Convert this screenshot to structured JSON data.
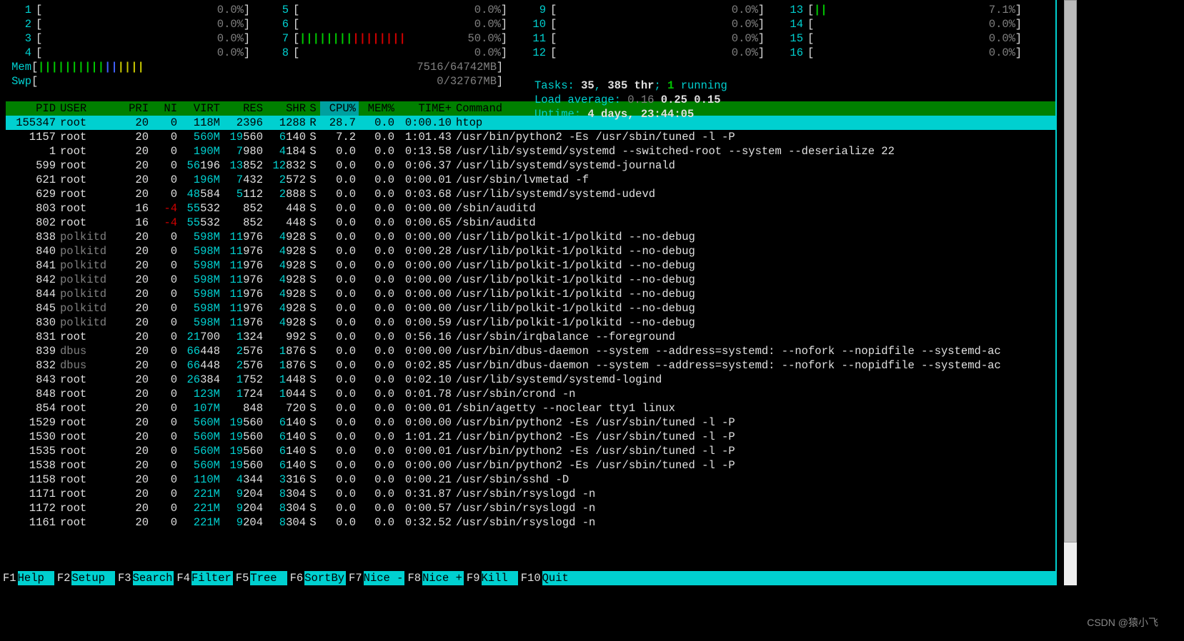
{
  "cpu_meters": [
    {
      "n": "1",
      "pct": "0.0%",
      "bars": ""
    },
    {
      "n": "2",
      "pct": "0.0%",
      "bars": ""
    },
    {
      "n": "3",
      "pct": "0.0%",
      "bars": ""
    },
    {
      "n": "4",
      "pct": "0.0%",
      "bars": ""
    },
    {
      "n": "5",
      "pct": "0.0%",
      "bars": ""
    },
    {
      "n": "6",
      "pct": "0.0%",
      "bars": ""
    },
    {
      "n": "7",
      "pct": "50.0%",
      "bars": "||||||||||||||||"
    },
    {
      "n": "8",
      "pct": "0.0%",
      "bars": ""
    },
    {
      "n": "9",
      "pct": "0.0%",
      "bars": ""
    },
    {
      "n": "10",
      "pct": "0.0%",
      "bars": ""
    },
    {
      "n": "11",
      "pct": "0.0%",
      "bars": ""
    },
    {
      "n": "12",
      "pct": "0.0%",
      "bars": ""
    },
    {
      "n": "13",
      "pct": "7.1%",
      "bars": "||"
    },
    {
      "n": "14",
      "pct": "0.0%",
      "bars": ""
    },
    {
      "n": "15",
      "pct": "0.0%",
      "bars": ""
    },
    {
      "n": "16",
      "pct": "0.0%",
      "bars": ""
    }
  ],
  "mem": {
    "label": "Mem",
    "used": "7516/64742MB",
    "bars": "||||||||||||||||"
  },
  "swp": {
    "label": "Swp",
    "used": "0/32767MB",
    "bars": ""
  },
  "stats": {
    "tasks_label": "Tasks: ",
    "tasks": "35",
    "tasks_sep": ", ",
    "thr": "385 thr",
    "thr_sep": "; ",
    "running": "1",
    "running_label": " running",
    "load_label": "Load average: ",
    "load1": "0.16",
    "load2": "0.25",
    "load3": "0.15",
    "uptime_label": "Uptime: ",
    "uptime": "4 days, 23:44:05"
  },
  "columns": {
    "pid": "PID",
    "user": "USER",
    "pri": "PRI",
    "ni": "NI",
    "virt": "VIRT",
    "res": "RES",
    "shr": "SHR",
    "s": "S",
    "cpu": "CPU%",
    "mem": "MEM%",
    "time": "TIME+",
    "cmd": "Command"
  },
  "procs": [
    {
      "pid": "155347",
      "user": "root",
      "usercls": "",
      "pri": "20",
      "ni": "0",
      "virt_hi": "",
      "virt": "118M",
      "res_hi": "",
      "res": "2396",
      "shr_hi": "",
      "shr": "1288",
      "s": "R",
      "cpu": "28.7",
      "mem": "0.0",
      "time": "0:00.10",
      "cmd": "htop",
      "sel": true
    },
    {
      "pid": "1157",
      "user": "root",
      "pri": "20",
      "ni": "0",
      "virt_hi": "",
      "virt": "560M",
      "res_hi": "19",
      "res": "560",
      "shr_hi": "6",
      "shr": "140",
      "s": "S",
      "cpu": "7.2",
      "mem": "0.0",
      "time": "1:01.43",
      "cmd": "/usr/bin/python2 -Es /usr/sbin/tuned -l -P"
    },
    {
      "pid": "1",
      "user": "root",
      "pri": "20",
      "ni": "0",
      "virt_hi": "",
      "virt": "190M",
      "res_hi": "7",
      "res": "980",
      "shr_hi": "4",
      "shr": "184",
      "s": "S",
      "cpu": "0.0",
      "mem": "0.0",
      "time": "0:13.58",
      "cmd": "/usr/lib/systemd/systemd --switched-root --system --deserialize 22"
    },
    {
      "pid": "599",
      "user": "root",
      "pri": "20",
      "ni": "0",
      "virt_hi": "56",
      "virt": "196",
      "res_hi": "13",
      "res": "852",
      "shr_hi": "12",
      "shr": "832",
      "s": "S",
      "cpu": "0.0",
      "mem": "0.0",
      "time": "0:06.37",
      "cmd": "/usr/lib/systemd/systemd-journald"
    },
    {
      "pid": "621",
      "user": "root",
      "pri": "20",
      "ni": "0",
      "virt_hi": "",
      "virt": "196M",
      "res_hi": "7",
      "res": "432",
      "shr_hi": "2",
      "shr": "572",
      "s": "S",
      "cpu": "0.0",
      "mem": "0.0",
      "time": "0:00.01",
      "cmd": "/usr/sbin/lvmetad -f"
    },
    {
      "pid": "629",
      "user": "root",
      "pri": "20",
      "ni": "0",
      "virt_hi": "48",
      "virt": "584",
      "res_hi": "5",
      "res": "112",
      "shr_hi": "2",
      "shr": "888",
      "s": "S",
      "cpu": "0.0",
      "mem": "0.0",
      "time": "0:03.68",
      "cmd": "/usr/lib/systemd/systemd-udevd"
    },
    {
      "pid": "803",
      "user": "root",
      "pri": "16",
      "ni": "-4",
      "nicls": "red",
      "virt_hi": "55",
      "virt": "532",
      "res_hi": "",
      "res": "852",
      "shr_hi": "",
      "shr": "448",
      "s": "S",
      "cpu": "0.0",
      "mem": "0.0",
      "time": "0:00.00",
      "cmd": "/sbin/auditd"
    },
    {
      "pid": "802",
      "user": "root",
      "pri": "16",
      "ni": "-4",
      "nicls": "red",
      "virt_hi": "55",
      "virt": "532",
      "res_hi": "",
      "res": "852",
      "shr_hi": "",
      "shr": "448",
      "s": "S",
      "cpu": "0.0",
      "mem": "0.0",
      "time": "0:00.65",
      "cmd": "/sbin/auditd"
    },
    {
      "pid": "838",
      "user": "polkitd",
      "usercls": "grey",
      "pri": "20",
      "ni": "0",
      "virt_hi": "",
      "virt": "598M",
      "res_hi": "11",
      "res": "976",
      "shr_hi": "4",
      "shr": "928",
      "s": "S",
      "cpu": "0.0",
      "mem": "0.0",
      "time": "0:00.00",
      "cmd": "/usr/lib/polkit-1/polkitd --no-debug"
    },
    {
      "pid": "840",
      "user": "polkitd",
      "usercls": "grey",
      "pri": "20",
      "ni": "0",
      "virt_hi": "",
      "virt": "598M",
      "res_hi": "11",
      "res": "976",
      "shr_hi": "4",
      "shr": "928",
      "s": "S",
      "cpu": "0.0",
      "mem": "0.0",
      "time": "0:00.28",
      "cmd": "/usr/lib/polkit-1/polkitd --no-debug"
    },
    {
      "pid": "841",
      "user": "polkitd",
      "usercls": "grey",
      "pri": "20",
      "ni": "0",
      "virt_hi": "",
      "virt": "598M",
      "res_hi": "11",
      "res": "976",
      "shr_hi": "4",
      "shr": "928",
      "s": "S",
      "cpu": "0.0",
      "mem": "0.0",
      "time": "0:00.00",
      "cmd": "/usr/lib/polkit-1/polkitd --no-debug"
    },
    {
      "pid": "842",
      "user": "polkitd",
      "usercls": "grey",
      "pri": "20",
      "ni": "0",
      "virt_hi": "",
      "virt": "598M",
      "res_hi": "11",
      "res": "976",
      "shr_hi": "4",
      "shr": "928",
      "s": "S",
      "cpu": "0.0",
      "mem": "0.0",
      "time": "0:00.00",
      "cmd": "/usr/lib/polkit-1/polkitd --no-debug"
    },
    {
      "pid": "844",
      "user": "polkitd",
      "usercls": "grey",
      "pri": "20",
      "ni": "0",
      "virt_hi": "",
      "virt": "598M",
      "res_hi": "11",
      "res": "976",
      "shr_hi": "4",
      "shr": "928",
      "s": "S",
      "cpu": "0.0",
      "mem": "0.0",
      "time": "0:00.00",
      "cmd": "/usr/lib/polkit-1/polkitd --no-debug"
    },
    {
      "pid": "845",
      "user": "polkitd",
      "usercls": "grey",
      "pri": "20",
      "ni": "0",
      "virt_hi": "",
      "virt": "598M",
      "res_hi": "11",
      "res": "976",
      "shr_hi": "4",
      "shr": "928",
      "s": "S",
      "cpu": "0.0",
      "mem": "0.0",
      "time": "0:00.00",
      "cmd": "/usr/lib/polkit-1/polkitd --no-debug"
    },
    {
      "pid": "830",
      "user": "polkitd",
      "usercls": "grey",
      "pri": "20",
      "ni": "0",
      "virt_hi": "",
      "virt": "598M",
      "res_hi": "11",
      "res": "976",
      "shr_hi": "4",
      "shr": "928",
      "s": "S",
      "cpu": "0.0",
      "mem": "0.0",
      "time": "0:00.59",
      "cmd": "/usr/lib/polkit-1/polkitd --no-debug"
    },
    {
      "pid": "831",
      "user": "root",
      "pri": "20",
      "ni": "0",
      "virt_hi": "21",
      "virt": "700",
      "res_hi": "1",
      "res": "324",
      "shr_hi": "",
      "shr": "992",
      "s": "S",
      "cpu": "0.0",
      "mem": "0.0",
      "time": "0:56.16",
      "cmd": "/usr/sbin/irqbalance --foreground"
    },
    {
      "pid": "839",
      "user": "dbus",
      "usercls": "grey",
      "pri": "20",
      "ni": "0",
      "virt_hi": "66",
      "virt": "448",
      "res_hi": "2",
      "res": "576",
      "shr_hi": "1",
      "shr": "876",
      "s": "S",
      "cpu": "0.0",
      "mem": "0.0",
      "time": "0:00.00",
      "cmd": "/usr/bin/dbus-daemon --system --address=systemd: --nofork --nopidfile --systemd-ac"
    },
    {
      "pid": "832",
      "user": "dbus",
      "usercls": "grey",
      "pri": "20",
      "ni": "0",
      "virt_hi": "66",
      "virt": "448",
      "res_hi": "2",
      "res": "576",
      "shr_hi": "1",
      "shr": "876",
      "s": "S",
      "cpu": "0.0",
      "mem": "0.0",
      "time": "0:02.85",
      "cmd": "/usr/bin/dbus-daemon --system --address=systemd: --nofork --nopidfile --systemd-ac"
    },
    {
      "pid": "843",
      "user": "root",
      "pri": "20",
      "ni": "0",
      "virt_hi": "26",
      "virt": "384",
      "res_hi": "1",
      "res": "752",
      "shr_hi": "1",
      "shr": "448",
      "s": "S",
      "cpu": "0.0",
      "mem": "0.0",
      "time": "0:02.10",
      "cmd": "/usr/lib/systemd/systemd-logind"
    },
    {
      "pid": "848",
      "user": "root",
      "pri": "20",
      "ni": "0",
      "virt_hi": "",
      "virt": "123M",
      "res_hi": "1",
      "res": "724",
      "shr_hi": "1",
      "shr": "044",
      "s": "S",
      "cpu": "0.0",
      "mem": "0.0",
      "time": "0:01.78",
      "cmd": "/usr/sbin/crond -n"
    },
    {
      "pid": "854",
      "user": "root",
      "pri": "20",
      "ni": "0",
      "virt_hi": "",
      "virt": "107M",
      "res_hi": "",
      "res": "848",
      "shr_hi": "",
      "shr": "720",
      "s": "S",
      "cpu": "0.0",
      "mem": "0.0",
      "time": "0:00.01",
      "cmd": "/sbin/agetty --noclear tty1 linux"
    },
    {
      "pid": "1529",
      "user": "root",
      "pri": "20",
      "ni": "0",
      "virt_hi": "",
      "virt": "560M",
      "res_hi": "19",
      "res": "560",
      "shr_hi": "6",
      "shr": "140",
      "s": "S",
      "cpu": "0.0",
      "mem": "0.0",
      "time": "0:00.00",
      "cmd": "/usr/bin/python2 -Es /usr/sbin/tuned -l -P"
    },
    {
      "pid": "1530",
      "user": "root",
      "pri": "20",
      "ni": "0",
      "virt_hi": "",
      "virt": "560M",
      "res_hi": "19",
      "res": "560",
      "shr_hi": "6",
      "shr": "140",
      "s": "S",
      "cpu": "0.0",
      "mem": "0.0",
      "time": "1:01.21",
      "cmd": "/usr/bin/python2 -Es /usr/sbin/tuned -l -P"
    },
    {
      "pid": "1535",
      "user": "root",
      "pri": "20",
      "ni": "0",
      "virt_hi": "",
      "virt": "560M",
      "res_hi": "19",
      "res": "560",
      "shr_hi": "6",
      "shr": "140",
      "s": "S",
      "cpu": "0.0",
      "mem": "0.0",
      "time": "0:00.01",
      "cmd": "/usr/bin/python2 -Es /usr/sbin/tuned -l -P"
    },
    {
      "pid": "1538",
      "user": "root",
      "pri": "20",
      "ni": "0",
      "virt_hi": "",
      "virt": "560M",
      "res_hi": "19",
      "res": "560",
      "shr_hi": "6",
      "shr": "140",
      "s": "S",
      "cpu": "0.0",
      "mem": "0.0",
      "time": "0:00.00",
      "cmd": "/usr/bin/python2 -Es /usr/sbin/tuned -l -P"
    },
    {
      "pid": "1158",
      "user": "root",
      "pri": "20",
      "ni": "0",
      "virt_hi": "",
      "virt": "110M",
      "res_hi": "4",
      "res": "344",
      "shr_hi": "3",
      "shr": "316",
      "s": "S",
      "cpu": "0.0",
      "mem": "0.0",
      "time": "0:00.21",
      "cmd": "/usr/sbin/sshd -D"
    },
    {
      "pid": "1171",
      "user": "root",
      "pri": "20",
      "ni": "0",
      "virt_hi": "",
      "virt": "221M",
      "res_hi": "9",
      "res": "204",
      "shr_hi": "8",
      "shr": "304",
      "s": "S",
      "cpu": "0.0",
      "mem": "0.0",
      "time": "0:31.87",
      "cmd": "/usr/sbin/rsyslogd -n"
    },
    {
      "pid": "1172",
      "user": "root",
      "pri": "20",
      "ni": "0",
      "virt_hi": "",
      "virt": "221M",
      "res_hi": "9",
      "res": "204",
      "shr_hi": "8",
      "shr": "304",
      "s": "S",
      "cpu": "0.0",
      "mem": "0.0",
      "time": "0:00.57",
      "cmd": "/usr/sbin/rsyslogd -n"
    },
    {
      "pid": "1161",
      "user": "root",
      "pri": "20",
      "ni": "0",
      "virt_hi": "",
      "virt": "221M",
      "res_hi": "9",
      "res": "204",
      "shr_hi": "8",
      "shr": "304",
      "s": "S",
      "cpu": "0.0",
      "mem": "0.0",
      "time": "0:32.52",
      "cmd": "/usr/sbin/rsyslogd -n"
    }
  ],
  "fn": [
    {
      "k": "F1",
      "l": "Help",
      "pad": true
    },
    {
      "k": "F2",
      "l": "Setup",
      "pad": true
    },
    {
      "k": "F3",
      "l": "Search"
    },
    {
      "k": "F4",
      "l": "Filter"
    },
    {
      "k": "F5",
      "l": "Tree",
      "pad": true
    },
    {
      "k": "F6",
      "l": "SortBy"
    },
    {
      "k": "F7",
      "l": "Nice -"
    },
    {
      "k": "F8",
      "l": "Nice +"
    },
    {
      "k": "F9",
      "l": "Kill",
      "pad": true
    },
    {
      "k": "F10",
      "l": "Quit"
    }
  ],
  "watermark": "CSDN @猿小飞"
}
